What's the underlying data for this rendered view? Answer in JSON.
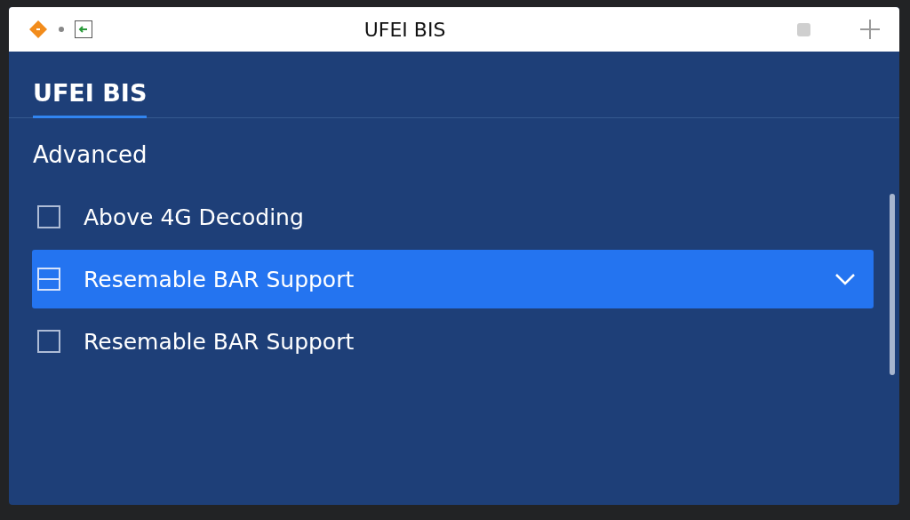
{
  "window": {
    "title": "UFEI BIS"
  },
  "tabs": [
    {
      "label": "UFEI BIS",
      "selected": true
    }
  ],
  "section": {
    "title": "Advanced"
  },
  "items": [
    {
      "label": "Above 4G Decoding",
      "selected": false
    },
    {
      "label": "Resemable BAR Support",
      "selected": true
    },
    {
      "label": "Resemable BAR Support",
      "selected": false
    }
  ]
}
